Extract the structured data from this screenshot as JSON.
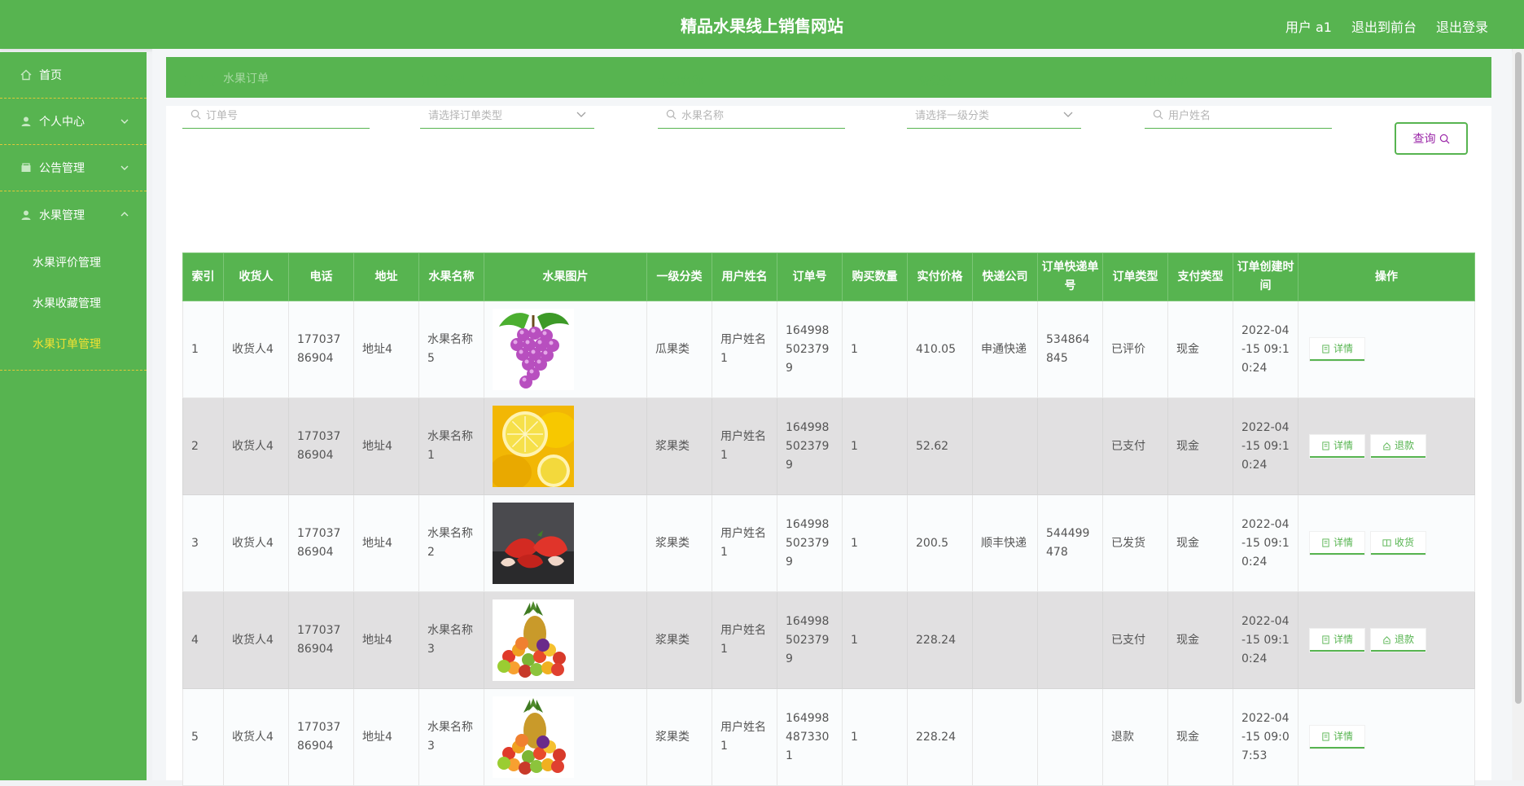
{
  "header": {
    "site_title": "精品水果线上销售网站",
    "user_label": "用户 a1",
    "to_front": "退出到前台",
    "logout": "退出登录"
  },
  "sidebar": {
    "home": "首页",
    "personal": "个人中心",
    "notice": "公告管理",
    "fruit": "水果管理",
    "sub_items": [
      "水果评价管理",
      "水果收藏管理",
      "水果订单管理"
    ]
  },
  "breadcrumb": "水果订单",
  "filters": {
    "order_no": {
      "label": "订单号",
      "placeholder": "订单号"
    },
    "order_type": {
      "label": "订单类型",
      "placeholder": "请选择订单类型"
    },
    "fruit_name": {
      "label": "水果名称",
      "placeholder": "水果名称"
    },
    "category": {
      "label": "一级分类",
      "placeholder": "请选择一级分类"
    },
    "user_name": {
      "label": "用户姓名",
      "placeholder": "用户姓名"
    }
  },
  "query_button": "查询",
  "table": {
    "headers": [
      "索引",
      "收货人",
      "电话",
      "地址",
      "水果名称",
      "水果图片",
      "一级分类",
      "用户姓名",
      "订单号",
      "购买数量",
      "实付价格",
      "快递公司",
      "订单快递单号",
      "订单类型",
      "支付类型",
      "订单创建时间",
      "操作"
    ],
    "rows": [
      {
        "index": "1",
        "receiver": "收货人4",
        "phone": "17703786904",
        "address": "地址4",
        "fruit": "水果名称5",
        "image": "grapes",
        "category": "瓜果类",
        "user": "用户姓名1",
        "order_no": "1649985023799",
        "qty": "1",
        "price": "410.05",
        "express": "申通快递",
        "tracking": "534864845",
        "order_type": "已评价",
        "pay_type": "现金",
        "created": "2022-04-15 09:10:24",
        "actions": [
          "详情"
        ]
      },
      {
        "index": "2",
        "receiver": "收货人4",
        "phone": "17703786904",
        "address": "地址4",
        "fruit": "水果名称1",
        "image": "lemons",
        "category": "浆果类",
        "user": "用户姓名1",
        "order_no": "1649985023799",
        "qty": "1",
        "price": "52.62",
        "express": "",
        "tracking": "",
        "order_type": "已支付",
        "pay_type": "现金",
        "created": "2022-04-15 09:10:24",
        "actions": [
          "详情",
          "退款"
        ]
      },
      {
        "index": "3",
        "receiver": "收货人4",
        "phone": "17703786904",
        "address": "地址4",
        "fruit": "水果名称2",
        "image": "strawberries",
        "category": "浆果类",
        "user": "用户姓名1",
        "order_no": "1649985023799",
        "qty": "1",
        "price": "200.5",
        "express": "顺丰快递",
        "tracking": "544499478",
        "order_type": "已发货",
        "pay_type": "现金",
        "created": "2022-04-15 09:10:24",
        "actions": [
          "详情",
          "收货"
        ]
      },
      {
        "index": "4",
        "receiver": "收货人4",
        "phone": "17703786904",
        "address": "地址4",
        "fruit": "水果名称3",
        "image": "fruit-pile",
        "category": "浆果类",
        "user": "用户姓名1",
        "order_no": "1649985023799",
        "qty": "1",
        "price": "228.24",
        "express": "",
        "tracking": "",
        "order_type": "已支付",
        "pay_type": "现金",
        "created": "2022-04-15 09:10:24",
        "actions": [
          "详情",
          "退款"
        ]
      },
      {
        "index": "5",
        "receiver": "收货人4",
        "phone": "17703786904",
        "address": "地址4",
        "fruit": "水果名称3",
        "image": "fruit-pile",
        "category": "浆果类",
        "user": "用户姓名1",
        "order_no": "1649984873301",
        "qty": "1",
        "price": "228.24",
        "express": "",
        "tracking": "",
        "order_type": "退款",
        "pay_type": "现金",
        "created": "2022-04-15 09:07:53",
        "actions": [
          "详情"
        ]
      }
    ]
  },
  "colors": {
    "primary": "#57b450",
    "active_sub": "#f2e233",
    "row_alt": "#e1e0e1"
  }
}
